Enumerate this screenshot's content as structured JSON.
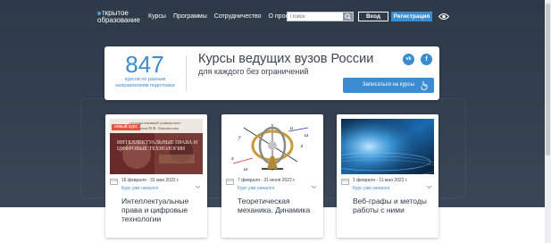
{
  "header": {
    "logo_line1": "ткрытое",
    "logo_line2": "образование",
    "nav": [
      "Курсы",
      "Программы",
      "Сотрудничество",
      "О проекте"
    ],
    "search_placeholder": "Поиск",
    "login_label": "Вход",
    "register_label": "Регистрация"
  },
  "banner": {
    "count": "847",
    "count_caption": "курсов по разным направлениям подготовки",
    "title": "Курсы ведущих вузов России",
    "subtitle": "для каждого без ограничений",
    "vk_label": "vk",
    "fb_label": "f",
    "signup_label": "Записаться на курсы"
  },
  "cards": [
    {
      "badge": "новый курс",
      "image_text": "ИНТЕЛЛЕКТУАЛЬНЫЕ ПРАВА И ЦИФРОВЫЕ ТЕХНОЛОГИИ",
      "date": "16 февраля - 31 мая 2022 г.",
      "status": "Курс уже начался",
      "title": "Интеллектуальные права и цифровые технологии"
    },
    {
      "date": "7 февраля - 31 июля 2022 г.",
      "status": "Курс уже начался",
      "title": "Теоретическая механика. Динамика"
    },
    {
      "date": "1 февраля - 11 мая 2022 г.",
      "status": "Курс уже начался",
      "title": "Веб-графы и методы работы с ними"
    }
  ],
  "colors": {
    "accent": "#3b8cd0",
    "hero_bg": "#2f3c4b",
    "badge": "#e8553d"
  }
}
